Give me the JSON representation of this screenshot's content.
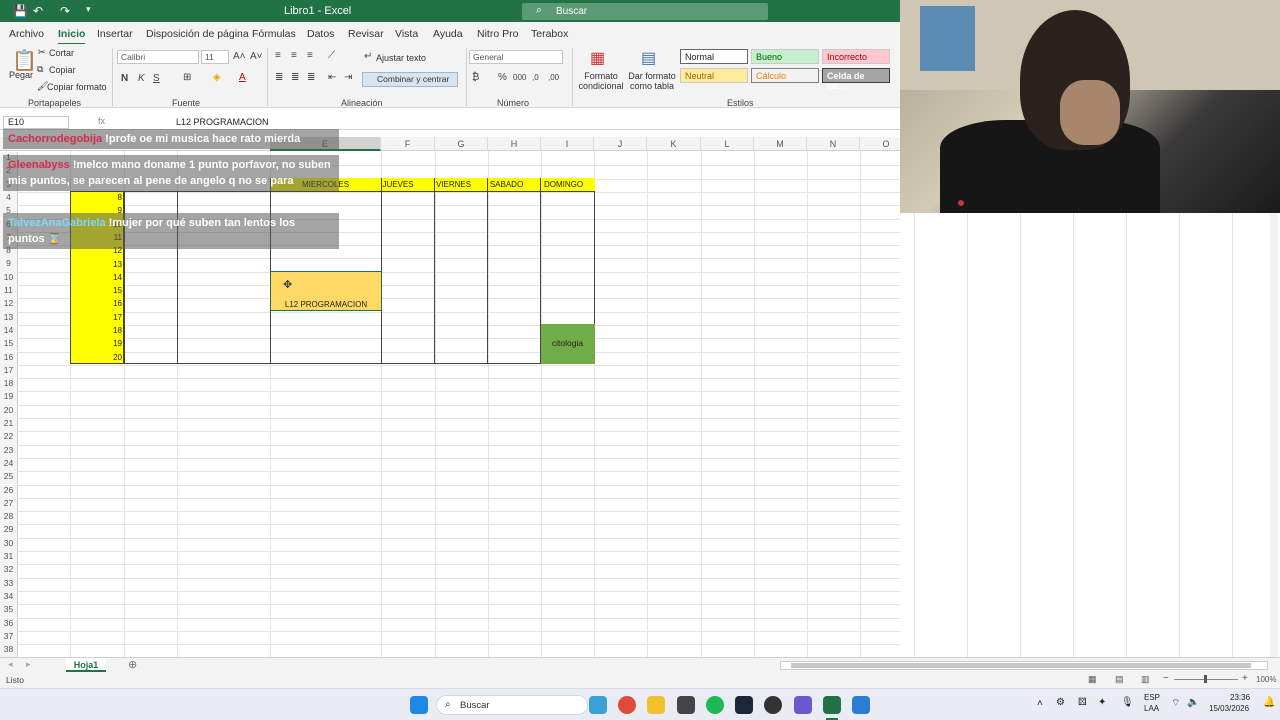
{
  "app": {
    "title": "Libro1 - Excel",
    "search": "Buscar"
  },
  "menu": [
    "Archivo",
    "Inicio",
    "Insertar",
    "Disposición de página",
    "Fórmulas",
    "Datos",
    "Revisar",
    "Vista",
    "Ayuda",
    "Nitro Pro",
    "Terabox"
  ],
  "ribbon": {
    "cortar": "Cortar",
    "copiar": "Copiar",
    "copiar_formato": "Copiar formato",
    "pegar": "Pegar",
    "font": "Calibri",
    "font_size": "11",
    "ajustar": "Ajustar texto",
    "combinar": "Combinar y centrar",
    "numfmt": "General",
    "formato_cond": "Formato condicional",
    "dar_formato": "Dar formato como tabla",
    "styles": {
      "normal": "Normal",
      "bueno": "Bueno",
      "incorrecto": "Incorrecto",
      "neutral": "Neutral",
      "calculo": "Cálculo",
      "celda": "Celda de co..."
    },
    "groups": {
      "portapapeles": "Portapapeles",
      "fuente": "Fuente",
      "alineacion": "Alineación",
      "numero": "Número",
      "estilos": "Estilos"
    }
  },
  "formula": {
    "namebox": "E10",
    "fx": "fx",
    "content": "L12 PROGRAMACION"
  },
  "columns": [
    "F",
    "G",
    "H",
    "I",
    "J",
    "K",
    "L",
    "M",
    "N",
    "O"
  ],
  "col_e_partial": "E",
  "rows": [
    "1",
    "2",
    "3",
    "4",
    "5",
    "6",
    "7",
    "8",
    "9",
    "10",
    "11",
    "12",
    "13",
    "14",
    "15",
    "16",
    "17",
    "18",
    "19",
    "20",
    "21",
    "22",
    "23",
    "24",
    "25",
    "26",
    "27",
    "28",
    "29",
    "30",
    "31",
    "32",
    "33",
    "34",
    "35",
    "36",
    "37",
    "38"
  ],
  "headers": {
    "miercoles": "MIERCOLES",
    "jueves": "JUEVES",
    "viernes": "VIERNES",
    "sabado": "SABADO",
    "domingo": "DOMINGO"
  },
  "hours": [
    "8",
    "9",
    "10",
    "11",
    "12",
    "13",
    "14",
    "15",
    "16",
    "17",
    "18",
    "19",
    "20"
  ],
  "cells": {
    "merged": "L12 PROGRAMACION",
    "citologia": "citologia"
  },
  "chat": [
    {
      "user": "Cachorrodegobija",
      "color": "#d72b4b",
      "text": " !profe oe mi musica hace rato mierda"
    },
    {
      "user": "Gleenabyss",
      "color": "#d72b4b",
      "text": " !melco mano doname 1 punto porfavor, no suben mis puntos, se parecen al pene de angelo q no se para"
    },
    {
      "user": "TalvezAnaGabriela",
      "color": "#7fd7ff",
      "text": " !mujer por qué suben tan lentos los puntos ⌛"
    }
  ],
  "sheet": {
    "tab": "Hoja1",
    "add": "⊕"
  },
  "status": {
    "ready": "Listo",
    "zoom": "100%"
  },
  "taskbar": {
    "search": "Buscar",
    "lang1": "ESP",
    "lang2": "LAA",
    "time": "23:36",
    "date": "15/03/2026"
  }
}
